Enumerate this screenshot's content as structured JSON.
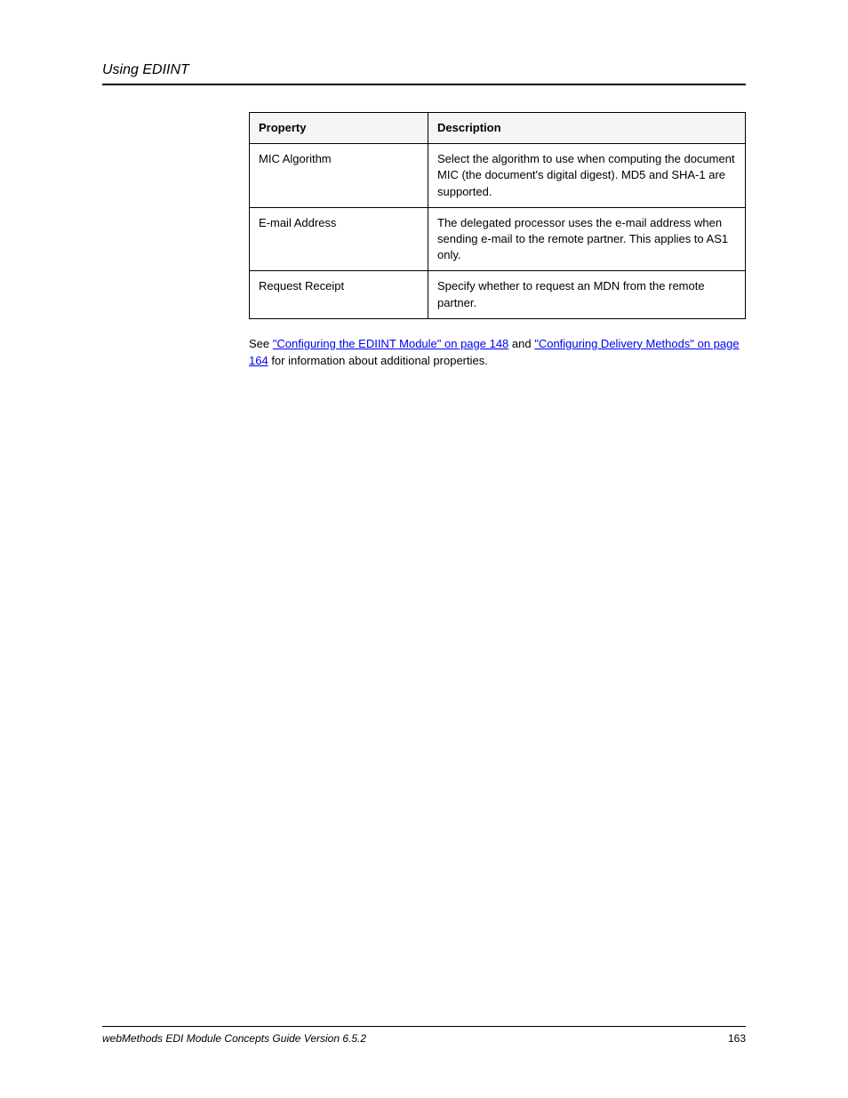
{
  "header": {
    "title": "Using EDIINT"
  },
  "table": {
    "headers": [
      "Property",
      "Description"
    ],
    "rows": [
      {
        "property": "MIC Algorithm",
        "description": "Select the algorithm to use when computing the document MIC (the document's digital digest). MD5 and SHA-1 are supported."
      },
      {
        "property": "E-mail Address",
        "description": "The delegated processor uses the e-mail address when sending e-mail to the remote partner. This applies to AS1 only."
      },
      {
        "property": "Request Receipt",
        "description": "Specify whether to request an MDN from the remote partner."
      }
    ]
  },
  "body": {
    "para": {
      "pre_link": "See ",
      "link1": "\"Configuring the EDIINT Module\" on page 148",
      "mid": " and ",
      "link2": "\"Configuring Delivery Methods\" on page 164",
      "post": " for information about additional properties."
    }
  },
  "footer": {
    "left": "webMethods EDI Module Concepts Guide Version 6.5.2",
    "right": "163"
  }
}
